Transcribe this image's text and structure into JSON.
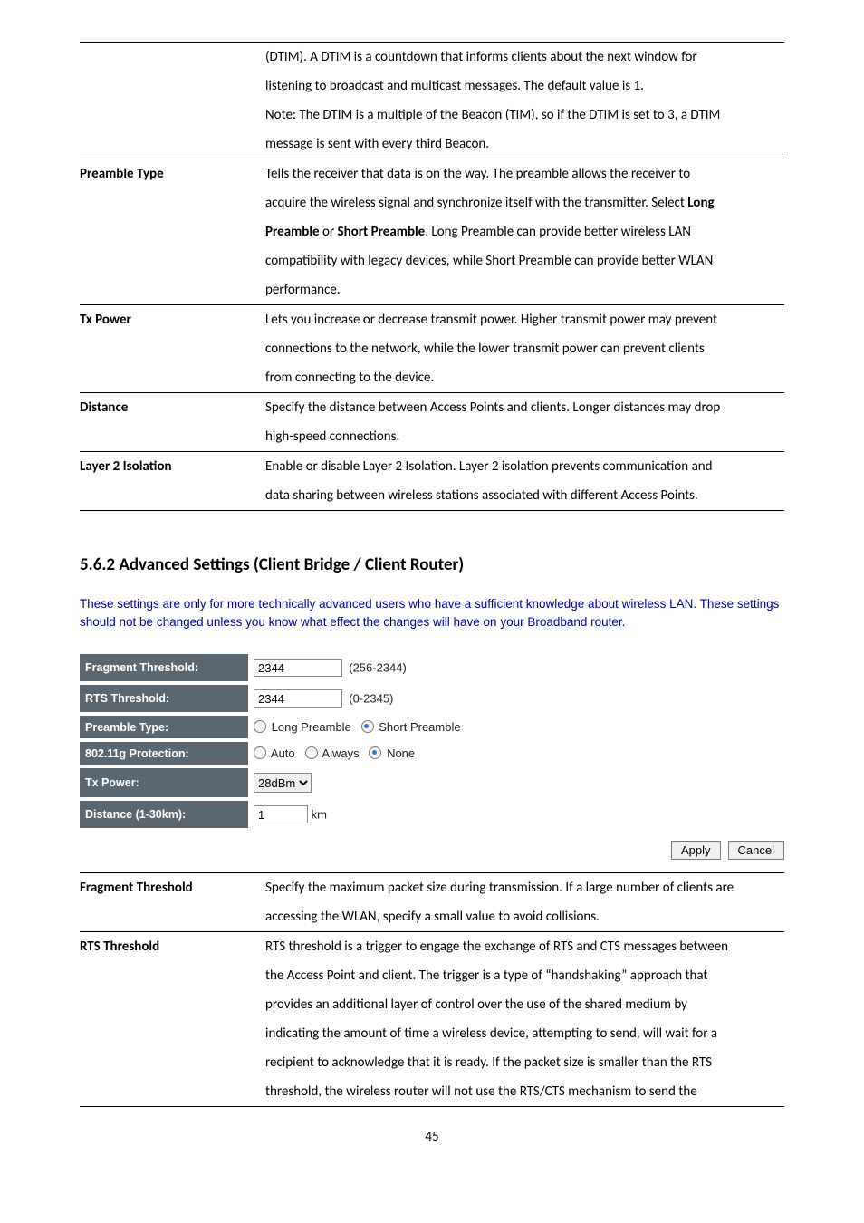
{
  "table1": {
    "rows": [
      {
        "term": "",
        "lines": [
          "(DTIM). A DTIM is a countdown that informs clients about the next window for",
          "listening to broadcast and multicast messages. The default value is 1.",
          "Note: The DTIM is a multiple of the Beacon (TIM), so if the DTIM is set to 3, a DTIM",
          "message is sent with every third Beacon."
        ]
      },
      {
        "term": "Preamble Type",
        "lines_html": [
          "Tells the receiver that data is on the way. The preamble allows the receiver to",
          "acquire the wireless signal and synchronize itself with the transmitter. Select <b>Long</b>",
          "<b>Preamble</b> or <b>Short Preamble</b>. Long Preamble can provide better wireless LAN",
          "compatibility with legacy devices, while Short Preamble can provide better WLAN",
          "performance."
        ]
      },
      {
        "term": "Tx Power",
        "lines": [
          "Lets you increase or decrease transmit power. Higher transmit power may prevent",
          "connections to the network, while the lower transmit power can prevent clients",
          "from connecting to the device."
        ]
      },
      {
        "term": "Distance",
        "lines": [
          "Specify the distance between Access Points and clients. Longer distances may drop",
          "high-speed connections."
        ]
      },
      {
        "term": "Layer 2 Isolation",
        "lines": [
          "Enable or disable Layer 2 Isolation. Layer 2 isolation prevents communication and",
          "data sharing between wireless stations associated with different Access Points."
        ]
      }
    ]
  },
  "section_heading": "5.6.2 Advanced Settings (Client Bridge / Client Router)",
  "intro": "These settings are only for more technically advanced users who have a sufficient knowledge about wireless LAN. These settings should not be changed unless you know what effect the changes will have on your Broadband router.",
  "settings": {
    "fragment": {
      "label": "Fragment Threshold:",
      "value": "2344",
      "range": "(256-2344)"
    },
    "rts": {
      "label": "RTS Threshold:",
      "value": "2344",
      "range": "(0-2345)"
    },
    "preamble": {
      "label": "Preamble Type:",
      "opts": [
        {
          "label": "Long Preamble",
          "selected": false
        },
        {
          "label": "Short Preamble",
          "selected": true
        }
      ]
    },
    "protection": {
      "label": "802.11g Protection:",
      "opts": [
        {
          "label": "Auto",
          "selected": false
        },
        {
          "label": "Always",
          "selected": false
        },
        {
          "label": "None",
          "selected": true
        }
      ]
    },
    "tx": {
      "label": "Tx Power:",
      "value": "28dBm"
    },
    "distance": {
      "label": "Distance (1-30km):",
      "value": "1",
      "unit": "km"
    }
  },
  "buttons": {
    "apply": "Apply",
    "cancel": "Cancel"
  },
  "table2": {
    "rows": [
      {
        "term": "Fragment Threshold",
        "lines": [
          "Specify the maximum packet size during transmission. If a large number of clients are",
          "accessing the WLAN, specify a small value to avoid collisions."
        ]
      },
      {
        "term": "RTS Threshold",
        "lines": [
          "RTS threshold is a trigger to engage the exchange of RTS and CTS messages between",
          "the Access Point and client. The trigger is a type of “handshaking” approach that",
          "provides an additional layer of control over the use of the shared medium by",
          "indicating the amount of time a wireless device, attempting to send, will wait for a",
          "recipient to acknowledge that it is ready. If the packet size is smaller than the RTS",
          "threshold, the wireless router will not use the RTS/CTS mechanism to send the"
        ]
      }
    ]
  },
  "page_number": "45"
}
